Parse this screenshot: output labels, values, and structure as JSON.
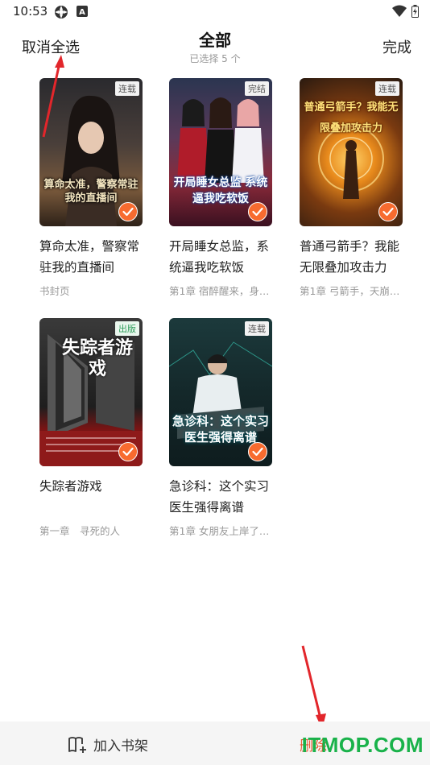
{
  "status_bar": {
    "time": "10:53"
  },
  "header": {
    "cancel_all": "取消全选",
    "title": "全部",
    "subtitle": "已选择 5 个",
    "done": "完成"
  },
  "books": [
    {
      "tag": "连载",
      "cover_title": "算命太准，警察常驻我的直播间",
      "name": "算命太准，警察常驻我的直播间",
      "sub": "书封页"
    },
    {
      "tag": "完结",
      "cover_title": "开局睡女总监 系统逼我吃软饭",
      "name": "开局睡女总监，系统逼我吃软饭",
      "sub": "第1章 宿醉醒来，身…"
    },
    {
      "tag": "连载",
      "cover_title": "普通弓箭手？我能无限叠加攻击力",
      "name": "普通弓箭手？我能无限叠加攻击力",
      "sub": "第1章 弓箭手，天崩…"
    },
    {
      "tag": "出版",
      "cover_title": "失踪者游戏",
      "name": "失踪者游戏",
      "sub": "第一章　寻死的人"
    },
    {
      "tag": "连载",
      "cover_title": "急诊科：这个实习医生强得离谱",
      "name": "急诊科：这个实习医生强得离谱",
      "sub": "第1章 女朋友上岸了…"
    }
  ],
  "bottom_bar": {
    "add_to_shelf": "加入书架",
    "delete": "删除",
    "watermark": "ITMOP.COM"
  },
  "colors": {
    "accent": "#f76b2f",
    "delete": "#e8542c",
    "tag_green": "#2e9d5a"
  }
}
